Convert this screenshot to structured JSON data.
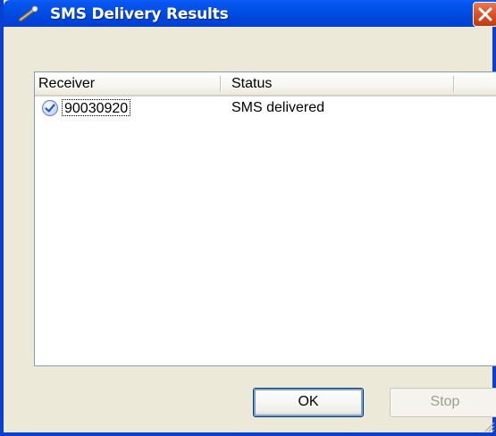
{
  "window": {
    "title": "SMS Delivery Results"
  },
  "list": {
    "columns": [
      "Receiver",
      "Status"
    ],
    "rows": [
      {
        "receiver": "90030920",
        "status": "SMS delivered",
        "icon": "check-circle-icon"
      }
    ]
  },
  "buttons": {
    "ok_label": "OK",
    "stop_label": "Stop"
  },
  "colors": {
    "titlebar": "#0050e6",
    "close": "#d94d26",
    "window_bg": "#ece9d8"
  }
}
